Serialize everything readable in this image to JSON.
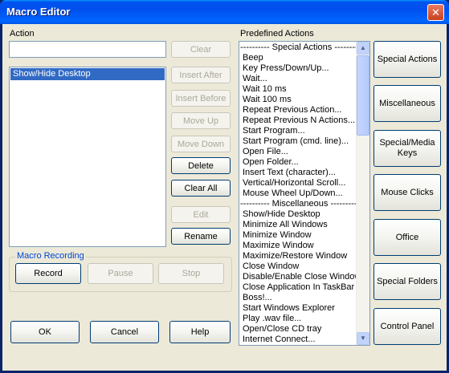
{
  "window": {
    "title": "Macro Editor",
    "close_glyph": "✕"
  },
  "action": {
    "label": "Action",
    "value": "",
    "clear": "Clear",
    "list_items": [
      "Show/Hide Desktop"
    ],
    "insert_after": "Insert After",
    "insert_before": "Insert Before",
    "move_up": "Move Up",
    "move_down": "Move Down",
    "delete": "Delete",
    "clear_all": "Clear All",
    "edit": "Edit",
    "rename": "Rename"
  },
  "recording": {
    "label": "Macro Recording",
    "record": "Record",
    "pause": "Pause",
    "stop": "Stop"
  },
  "footer": {
    "ok": "OK",
    "cancel": "Cancel",
    "help": "Help"
  },
  "predefined": {
    "label": "Predefined Actions",
    "items": [
      "---------- Special Actions ----------",
      "Beep",
      "Key Press/Down/Up...",
      "Wait...",
      "Wait 10 ms",
      "Wait 100 ms",
      "Repeat Previous Action...",
      "Repeat Previous N Actions...",
      "Start Program...",
      "Start Program (cmd. line)...",
      "Open File...",
      "Open Folder...",
      "Insert Text (character)...",
      "Vertical/Horizontal Scroll...",
      "Mouse Wheel Up/Down...",
      "---------- Miscellaneous ----------",
      "Show/Hide Desktop",
      "Minimize All Windows",
      "Minimize Window",
      "Maximize Window",
      "Maximize/Restore Window",
      "Close Window",
      "Disable/Enable Close Window",
      "Close Application In TaskBar",
      "Boss!...",
      "Start Windows Explorer",
      "Play .wav file...",
      "Open/Close CD tray",
      "Internet Connect..."
    ]
  },
  "categories": [
    "Special Actions",
    "Miscellaneous",
    "Special/Media Keys",
    "Mouse Clicks",
    "Office",
    "Special Folders",
    "Control Panel"
  ]
}
